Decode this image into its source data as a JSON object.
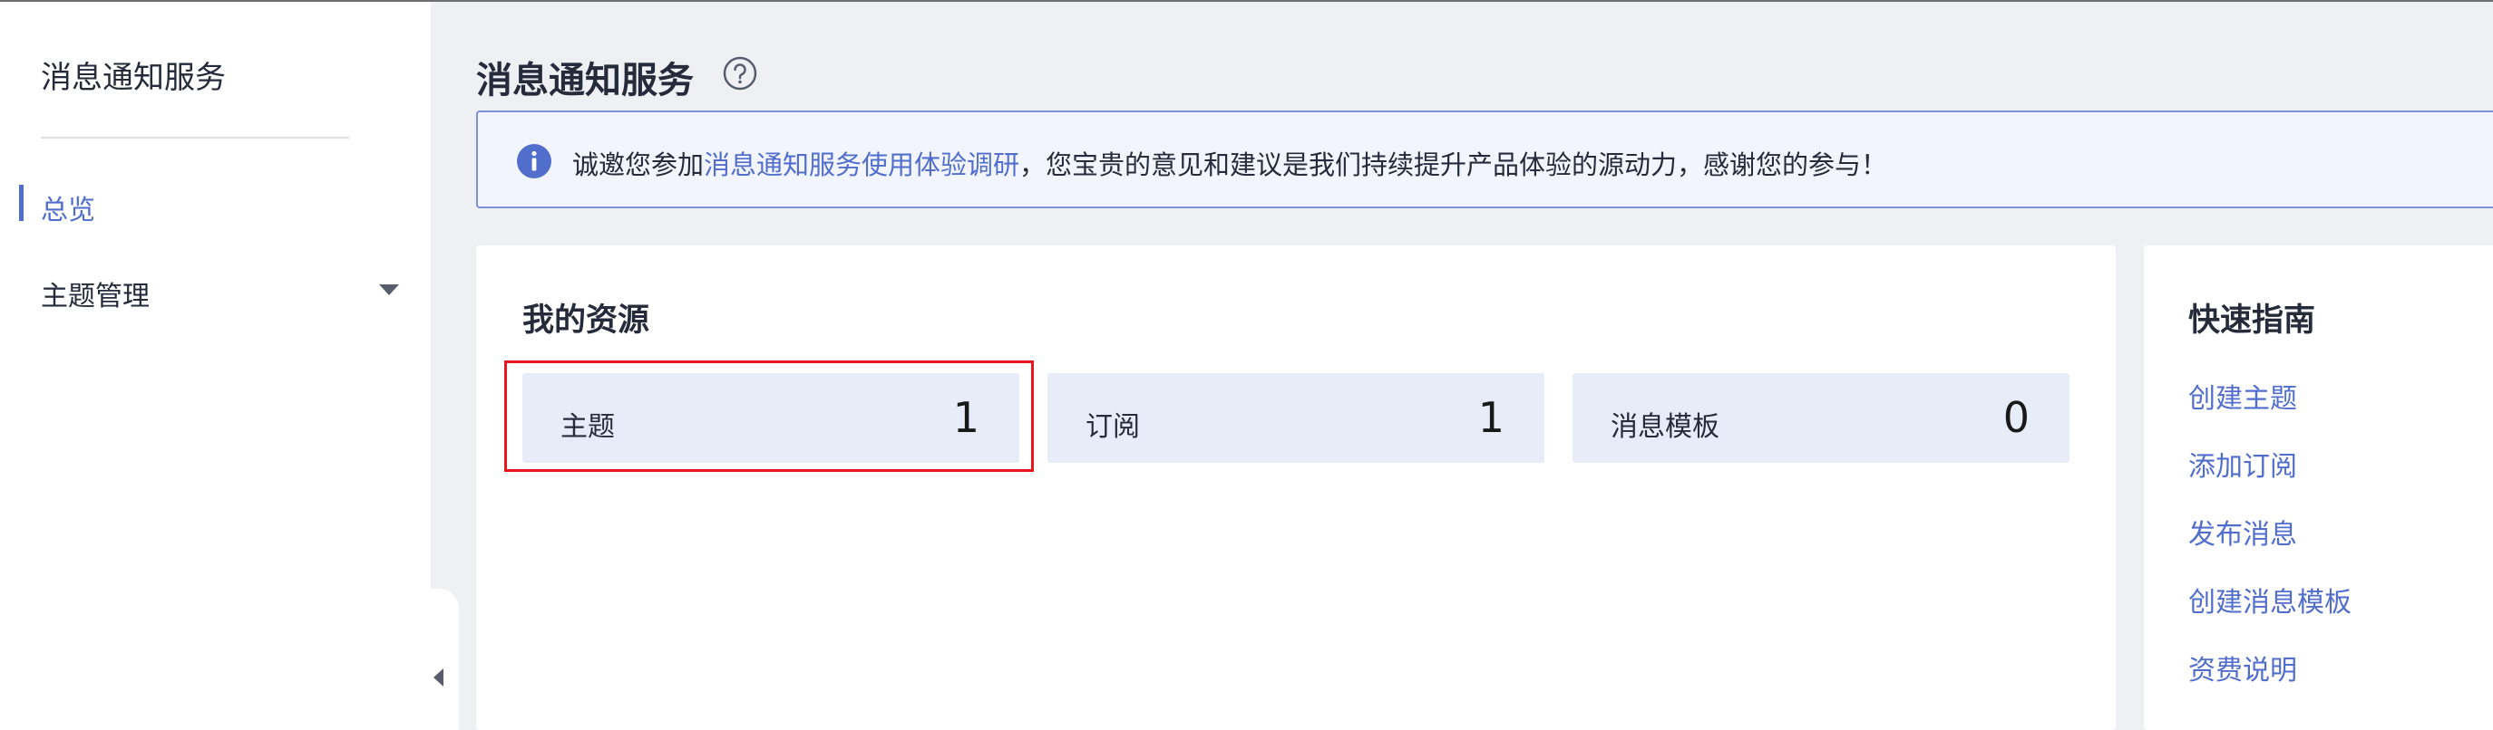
{
  "sidebar": {
    "title": "消息通知服务",
    "items": [
      {
        "label": "总览",
        "active": true
      },
      {
        "label": "主题管理",
        "expandable": true
      }
    ]
  },
  "header": {
    "title": "消息通知服务",
    "help_icon": "question-circle-icon"
  },
  "notice": {
    "icon": "info-icon",
    "prefix": "诚邀您参加",
    "link_text": "消息通知服务使用体验调研",
    "suffix": "，您宝贵的意见和建议是我们持续提升产品体验的源动力，感谢您的参与！"
  },
  "resources": {
    "title": "我的资源",
    "tiles": [
      {
        "name": "主题",
        "count": "1"
      },
      {
        "name": "订阅",
        "count": "1"
      },
      {
        "name": "消息模板",
        "count": "0"
      }
    ]
  },
  "guide": {
    "title": "快速指南",
    "links": [
      "创建主题",
      "添加订阅",
      "发布消息",
      "创建消息模板",
      "资费说明"
    ]
  },
  "colors": {
    "accent": "#526ecc",
    "highlight": "#e8161d",
    "page_bg": "#eff0f4",
    "tile_bg": "#e8ecf8"
  }
}
